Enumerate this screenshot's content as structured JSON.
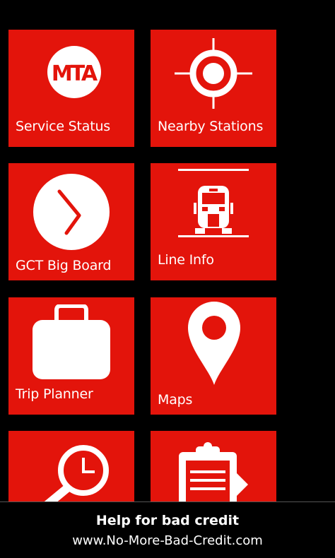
{
  "tiles": [
    {
      "label": "Service Status",
      "icon": "mta-logo-icon"
    },
    {
      "label": "Nearby Stations",
      "icon": "crosshair-location-icon"
    },
    {
      "label": "GCT Big Board",
      "icon": "clock-icon"
    },
    {
      "label": "Line Info",
      "icon": "train-front-icon"
    },
    {
      "label": "Trip Planner",
      "icon": "briefcase-icon"
    },
    {
      "label": "Maps",
      "icon": "map-pin-icon"
    },
    {
      "label": "",
      "icon": "schedule-search-icon"
    },
    {
      "label": "",
      "icon": "clipboard-icon"
    }
  ],
  "logo_text": "MTA",
  "ad": {
    "headline": "Help for bad credit",
    "url": "www.No-More-Bad-Credit.com"
  },
  "colors": {
    "tile": "#e3140b",
    "background": "#000000",
    "text": "#ffffff"
  }
}
